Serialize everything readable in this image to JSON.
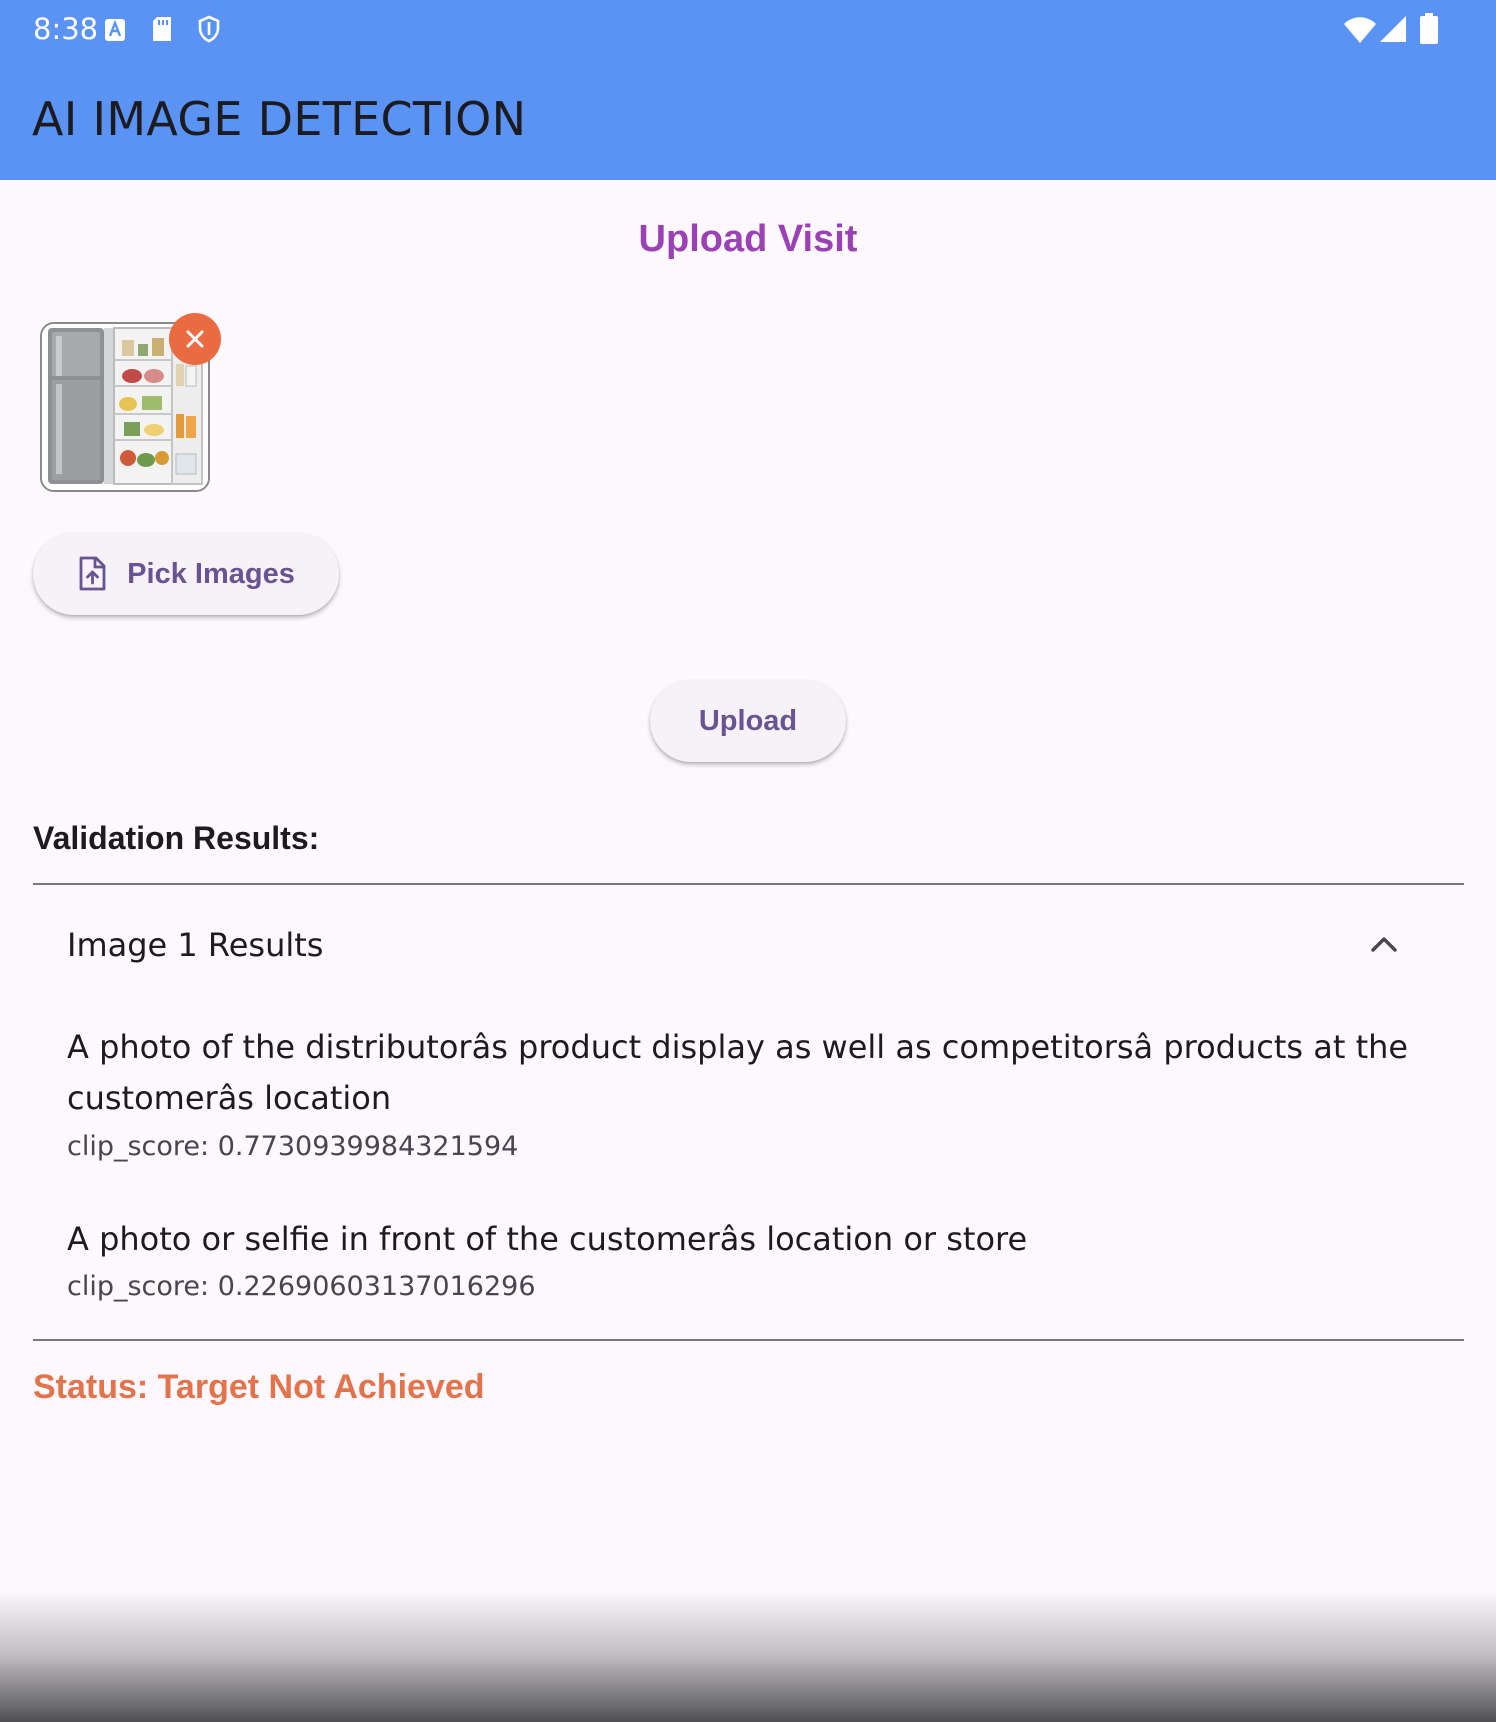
{
  "status_bar": {
    "time": "8:38",
    "left_icons": [
      "font-a-icon",
      "sd-card-icon",
      "shield-icon"
    ],
    "right_icons": [
      "wifi-icon",
      "signal-icon",
      "battery-icon"
    ]
  },
  "app_bar": {
    "title": "AI IMAGE DETECTION",
    "background": "#5b93f5"
  },
  "page": {
    "heading": "Upload Visit",
    "heading_color": "#9b41b6"
  },
  "images": {
    "thumbnail_icon": "refrigerator-image",
    "remove_icon": "close-icon",
    "remove_color": "#ea6a42"
  },
  "actions": {
    "pick_label": "Pick Images",
    "pick_icon": "file-upload-icon",
    "upload_label": "Upload",
    "accent": "#675493"
  },
  "validation": {
    "heading": "Validation Results:",
    "panel_title": "Image 1 Results",
    "panel_icon": "chevron-up-icon",
    "results": [
      {
        "description": "A photo of the distributorâs product display as well as competitorsâ products at the customerâs location",
        "score": "clip_score: 0.7730939984321594"
      },
      {
        "description": "A photo or selfie in front of the customerâs location or store",
        "score": "clip_score: 0.22690603137016296"
      }
    ]
  },
  "status": {
    "text": "Status: Target Not Achieved",
    "color": "#e3734b"
  }
}
